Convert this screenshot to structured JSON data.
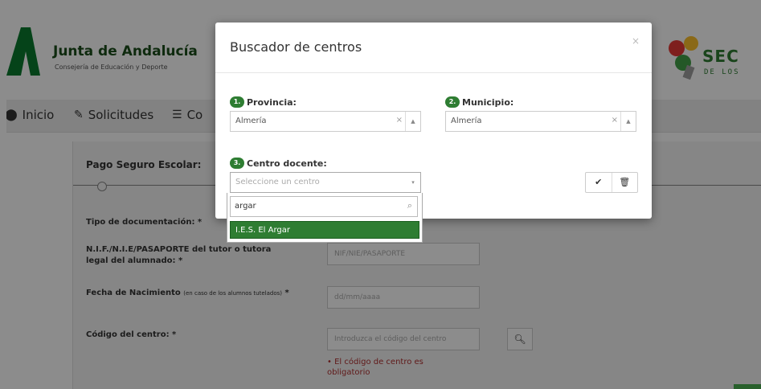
{
  "header": {
    "brand_title": "Junta de Andalucía",
    "brand_subtitle": "Consejería de Educación y Deporte",
    "right_logo_text": "SEC",
    "right_logo_sub": "DE LOS"
  },
  "nav": {
    "items": [
      {
        "label": "Inicio",
        "icon": "marker-icon"
      },
      {
        "label": "Solicitudes",
        "icon": "pencil-icon"
      },
      {
        "label": "Co",
        "icon": "list-icon"
      }
    ]
  },
  "form": {
    "section_title": "Pago Seguro Escolar:",
    "doc_type_label": "Tipo de documentación: *",
    "nif_label": "N.I.F./N.I.E/PASAPORTE del tutor o tutora legal del alumnado: *",
    "nif_placeholder": "NIF/NIE/PASAPORTE",
    "birth_label": "Fecha de Nacimiento",
    "birth_label_note": "(en caso de los alumnos tutelados)",
    "birth_label_star": "*",
    "birth_placeholder": "dd/mm/aaaa",
    "center_code_label": "Código del centro: *",
    "center_code_placeholder": "Introduzca el código del centro",
    "error_message": "• El código de centro es obligatorio"
  },
  "modal": {
    "title": "Buscador de centros",
    "close": "×",
    "step1": {
      "badge": "1.",
      "label": "Provincia:",
      "value": "Almería"
    },
    "step2": {
      "badge": "2.",
      "label": "Municipio:",
      "value": "Almería"
    },
    "step3": {
      "badge": "3.",
      "label": "Centro docente:",
      "placeholder": "Seleccione un centro"
    },
    "clear_symbol": "×",
    "search_text": "argar",
    "option": "I.E.S. El Argar",
    "confirm_symbol": "✔",
    "delete_symbol": "🗑"
  },
  "colors": {
    "accent": "#2e7d32",
    "error": "#b03030"
  }
}
